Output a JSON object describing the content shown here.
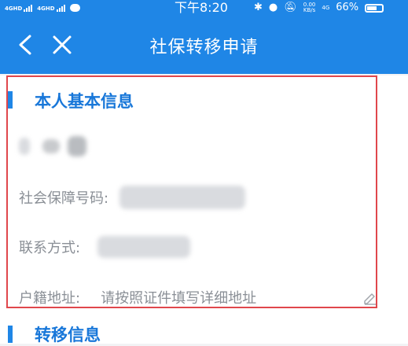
{
  "status_bar": {
    "signal1": "4GHD",
    "signal2": "4GHD",
    "time": "下午8:20",
    "speed": "0.00\nKB/s",
    "net": "4G",
    "battery": "66%"
  },
  "nav": {
    "title": "社保转移申请"
  },
  "personal_section": {
    "title": "本人基本信息",
    "social_security_label": "社会保障号码:",
    "contact_label": "联系方式:",
    "address_label": "户籍地址:",
    "address_placeholder": "请按照证件填写详细地址"
  },
  "transfer_section": {
    "title": "转移信息"
  }
}
